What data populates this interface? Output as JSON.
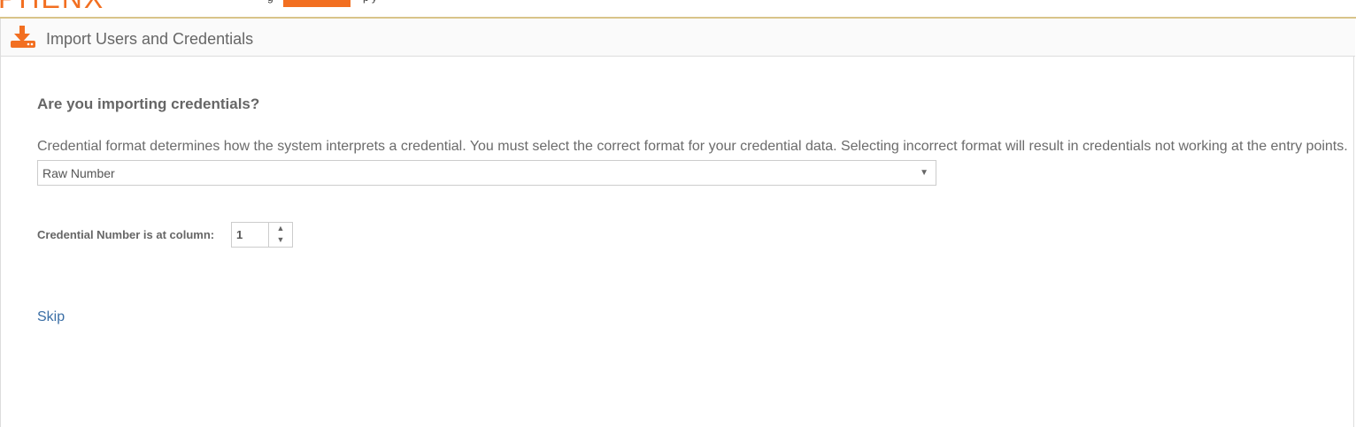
{
  "brand": {
    "logo_text": "PHENX",
    "accent_color": "#f26f21"
  },
  "top_nav": {
    "partial_left": "g",
    "partial_right": "p     y"
  },
  "header": {
    "icon": "import-download-icon",
    "title": "Import Users and Credentials"
  },
  "form": {
    "question": "Are you importing credentials?",
    "description": "Credential format determines how the system interprets a credential. You must select the correct format for your credential data. Selecting incorrect format will result in credentials not working at the entry points.",
    "format_select": {
      "selected": "Raw Number"
    },
    "column_label": "Credential Number is at column:",
    "column_value": "1"
  },
  "actions": {
    "skip_label": "Skip",
    "link_color": "#3a6ea5"
  }
}
